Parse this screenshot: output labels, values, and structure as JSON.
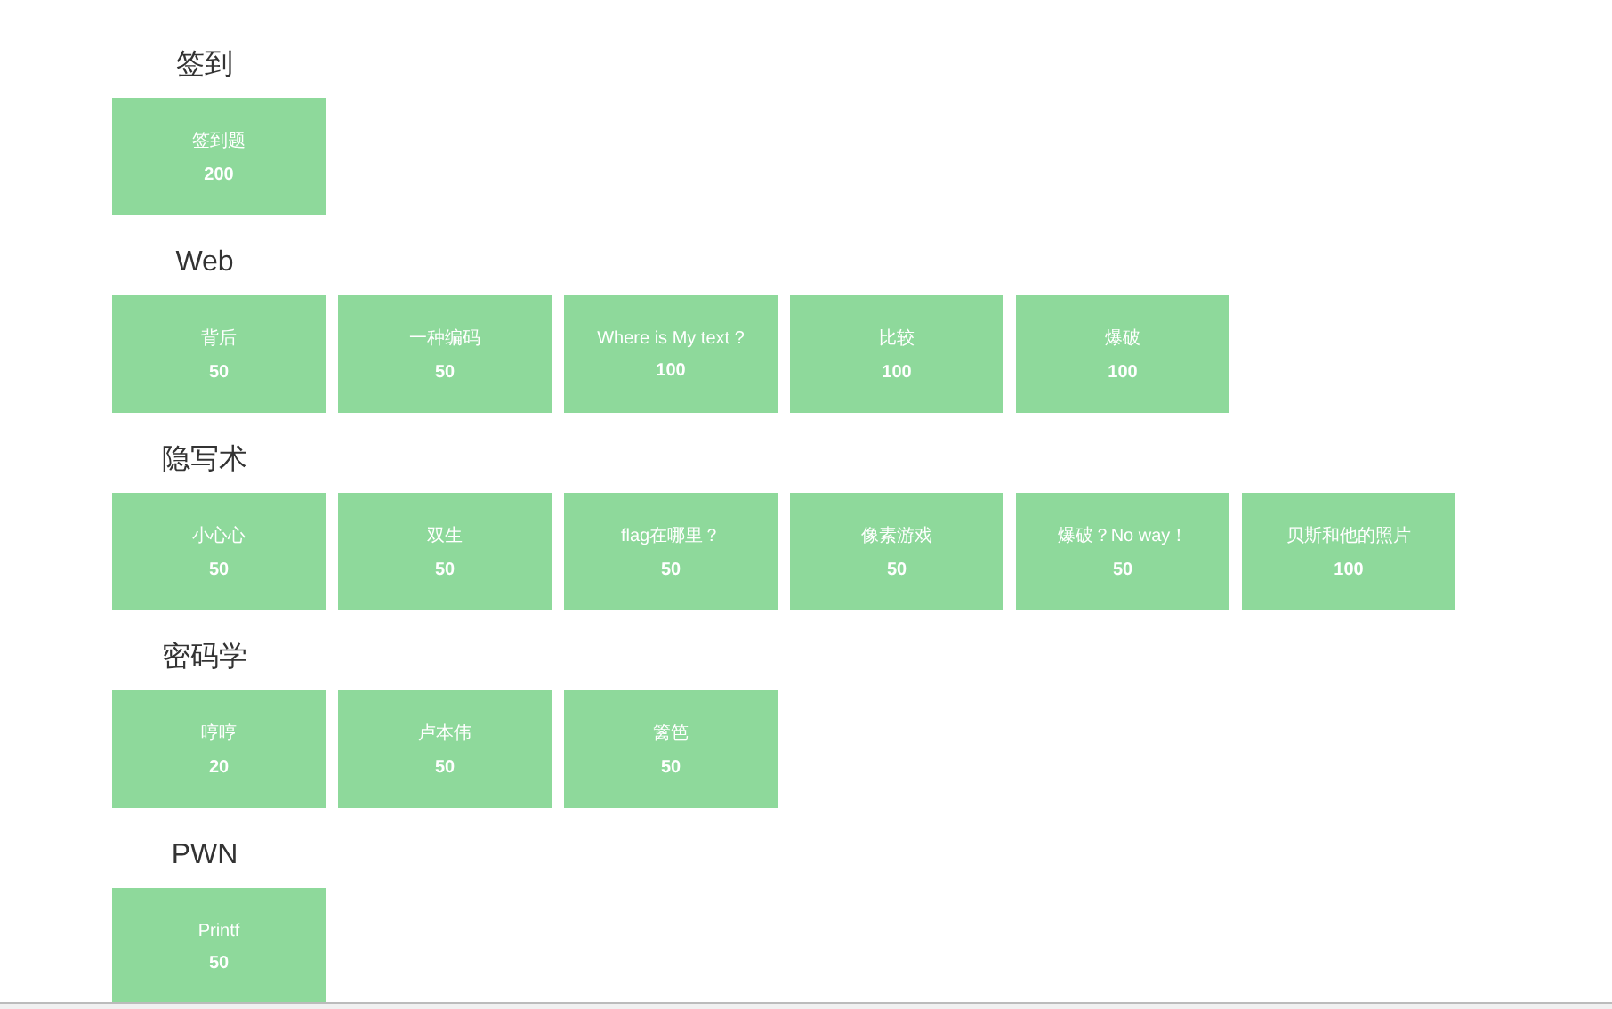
{
  "categories": [
    {
      "title": "签到",
      "challenges": [
        {
          "name": "签到题",
          "points": "200"
        }
      ]
    },
    {
      "title": "Web",
      "challenges": [
        {
          "name": "背后",
          "points": "50"
        },
        {
          "name": "一种编码",
          "points": "50"
        },
        {
          "name": "Where is My text ?",
          "points": "100"
        },
        {
          "name": "比较",
          "points": "100"
        },
        {
          "name": "爆破",
          "points": "100"
        }
      ]
    },
    {
      "title": "隐写术",
      "challenges": [
        {
          "name": "小心心",
          "points": "50"
        },
        {
          "name": "双生",
          "points": "50"
        },
        {
          "name": "flag在哪里？",
          "points": "50"
        },
        {
          "name": "像素游戏",
          "points": "50"
        },
        {
          "name": "爆破？No way！",
          "points": "50"
        },
        {
          "name": "贝斯和他的照片",
          "points": "100"
        }
      ]
    },
    {
      "title": "密码学",
      "challenges": [
        {
          "name": "哼哼",
          "points": "20"
        },
        {
          "name": "卢本伟",
          "points": "50"
        },
        {
          "name": "篱笆",
          "points": "50"
        }
      ]
    },
    {
      "title": "PWN",
      "challenges": [
        {
          "name": "Printf",
          "points": "50"
        }
      ]
    }
  ]
}
